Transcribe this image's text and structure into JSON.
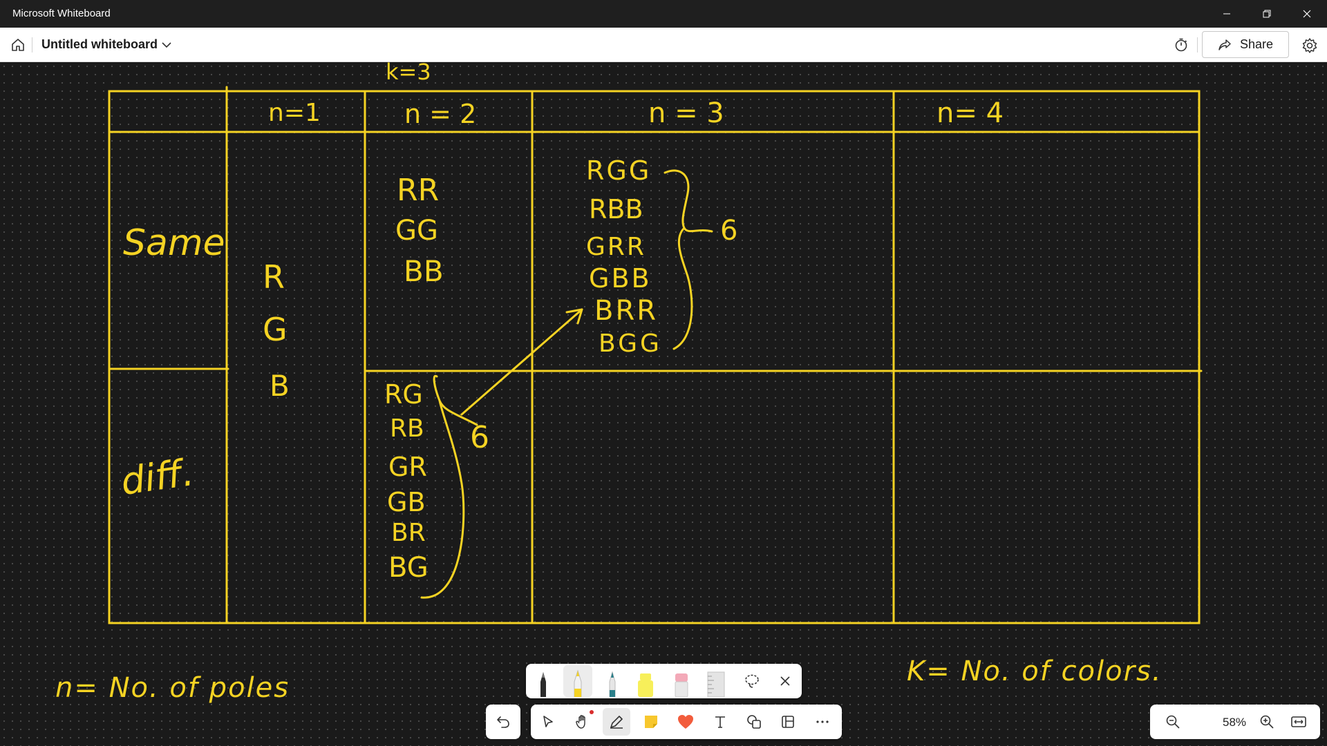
{
  "window": {
    "title": "Microsoft Whiteboard"
  },
  "header": {
    "board_title": "Untitled whiteboard",
    "share_label": "Share"
  },
  "board": {
    "k_note": "k=3",
    "columns": [
      "n=1",
      "n = 2",
      "n = 3",
      "n= 4"
    ],
    "rows": [
      "Same",
      "diff."
    ],
    "n1_colors": [
      "R",
      "G",
      "B"
    ],
    "n2_same": [
      "RR",
      "GG",
      "BB"
    ],
    "n2_diff": [
      "RG",
      "RB",
      "GR",
      "GB",
      "BR",
      "BG"
    ],
    "n2_diff_count": "6",
    "n3_same": [
      "RGG",
      "RBB",
      "GRR",
      "GBB",
      "BRR",
      "BGG"
    ],
    "n3_same_count": "6",
    "footnote_n": "n= No. of poles",
    "footnote_k": "K= No. of colors."
  },
  "ink_color": "#f5d323",
  "zoom": {
    "value": "58%"
  }
}
